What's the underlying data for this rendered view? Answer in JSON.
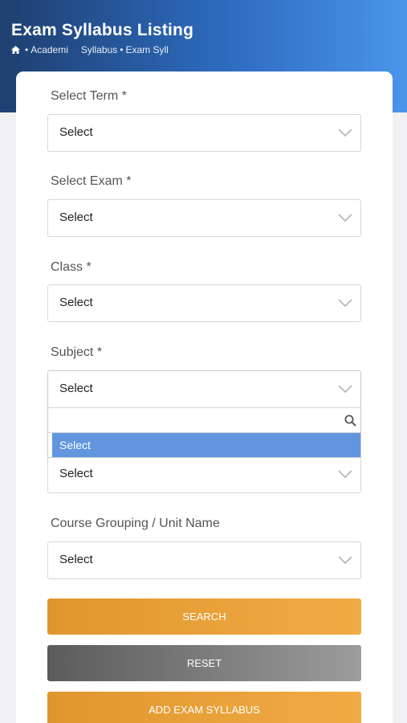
{
  "header": {
    "title": "Exam Syllabus Listing",
    "breadcrumb": [
      "Academi",
      "Syllabus",
      "Exam Syll"
    ]
  },
  "form": {
    "fields": [
      {
        "label": "Select Term *",
        "value": "Select"
      },
      {
        "label": "Select Exam *",
        "value": "Select"
      },
      {
        "label": "Class *",
        "value": "Select"
      },
      {
        "label": "Subject *",
        "value": "Select"
      },
      {
        "label": "",
        "value": "Select"
      },
      {
        "label": "Course Grouping / Unit Name",
        "value": "Select"
      }
    ],
    "subject_dropdown": {
      "search_value": "",
      "options": [
        "Select"
      ]
    }
  },
  "buttons": {
    "search": "SEARCH",
    "reset": "RESET",
    "add": "ADD EXAM SYLLABUS"
  },
  "colors": {
    "header_start": "#1e3f6f",
    "header_end": "#4a95ea",
    "accent_orange": "#f1ab45",
    "reset_gray": "#6b6b6b",
    "option_highlight": "#6196df"
  }
}
